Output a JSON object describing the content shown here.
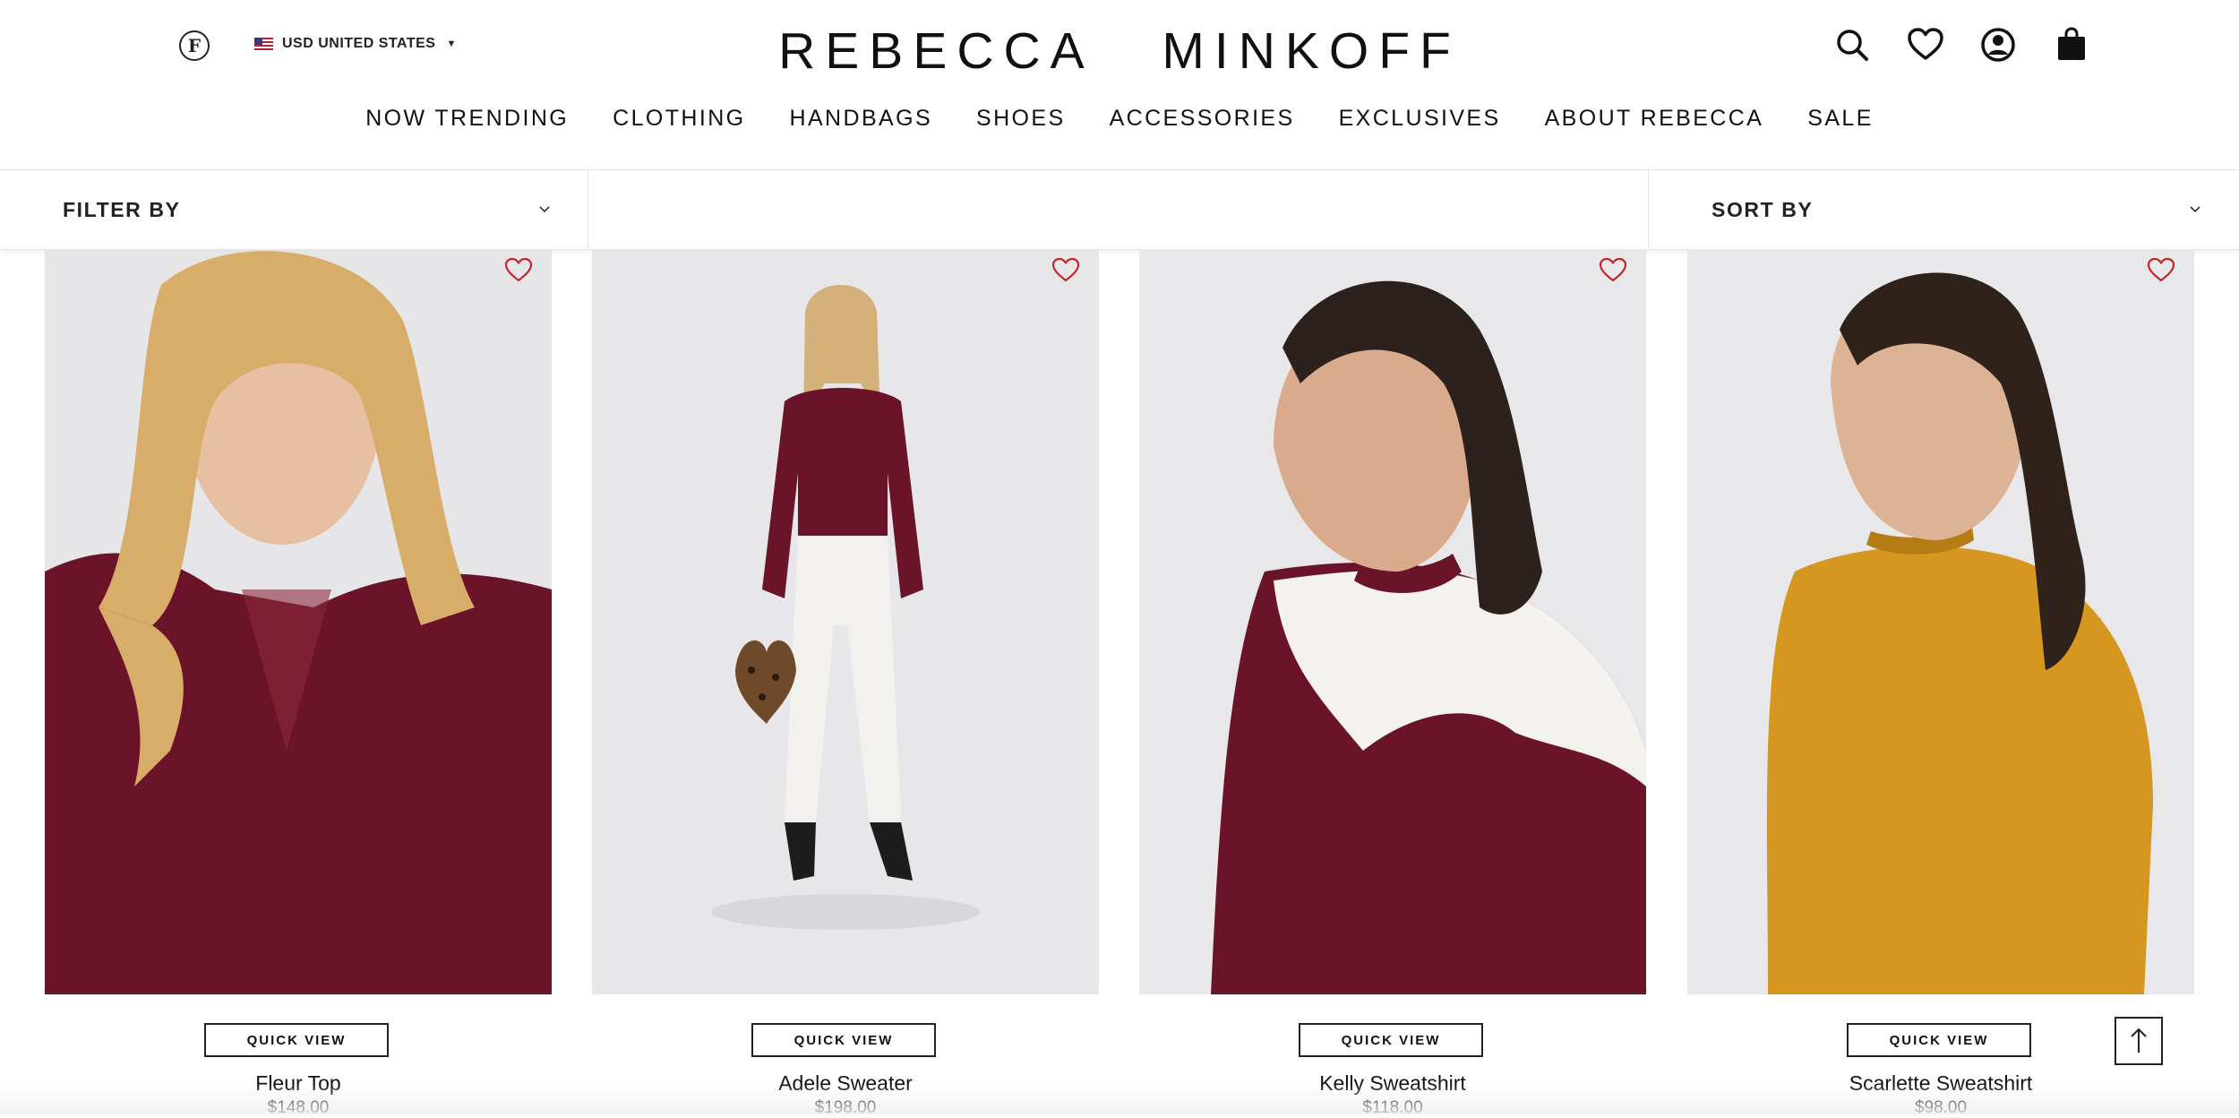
{
  "header": {
    "logo_letter": "F",
    "currency_label": "USD UNITED STATES",
    "brand_left": "REBECCA",
    "brand_right": "MINKOFF",
    "icons": [
      "search-icon",
      "heart-icon",
      "account-icon",
      "bag-icon"
    ]
  },
  "nav": {
    "items": [
      {
        "label": "NOW TRENDING"
      },
      {
        "label": "CLOTHING"
      },
      {
        "label": "HANDBAGS"
      },
      {
        "label": "SHOES"
      },
      {
        "label": "ACCESSORIES"
      },
      {
        "label": "EXCLUSIVES"
      },
      {
        "label": "ABOUT REBECCA"
      },
      {
        "label": "SALE"
      }
    ]
  },
  "filters": {
    "filter_label": "FILTER BY",
    "sort_label": "SORT BY"
  },
  "products": [
    {
      "name": "Fleur Top",
      "price": "$148.00",
      "quick_view": "QUICK VIEW",
      "color": "#6b1328"
    },
    {
      "name": "Adele Sweater",
      "price": "$198.00",
      "quick_view": "QUICK VIEW",
      "color": "#6b1328"
    },
    {
      "name": "Kelly Sweatshirt",
      "price": "$118.00",
      "quick_view": "QUICK VIEW",
      "color": "#6b1328"
    },
    {
      "name": "Scarlette Sweatshirt",
      "price": "$98.00",
      "quick_view": "QUICK VIEW",
      "color": "#d5971f"
    }
  ],
  "colors": {
    "wishlist_heart": "#c0272d",
    "text": "#111111",
    "border": "#e3e3e3"
  }
}
